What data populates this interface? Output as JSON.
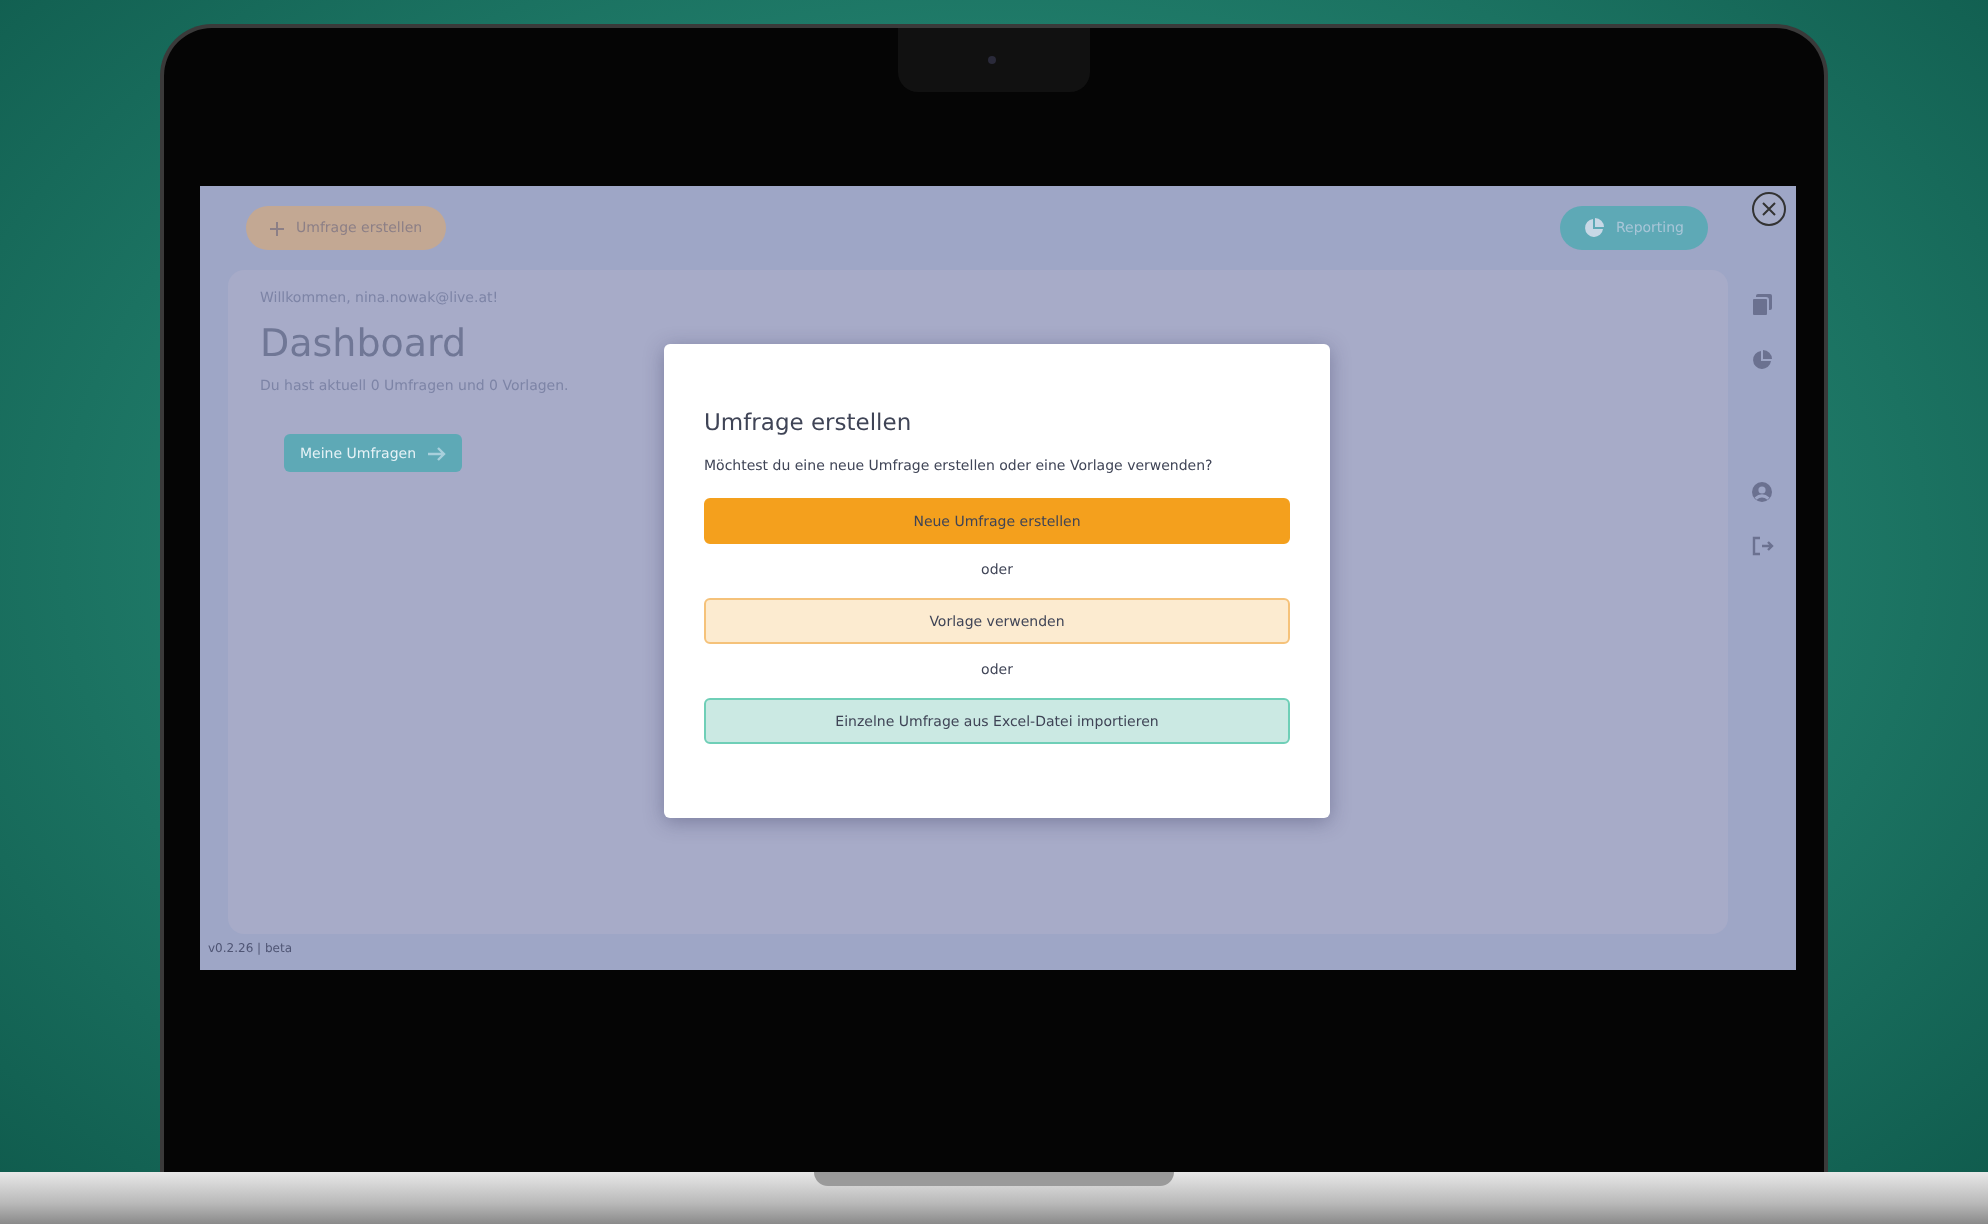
{
  "app": {
    "create_button": "Umfrage erstellen",
    "reporting_button": "Reporting",
    "welcome": "Willkommen, nina.nowak@live.at!",
    "title": "Dashboard",
    "summary": "Du hast aktuell 0 Umfragen und 0 Vorlagen.",
    "my_surveys_button": "Meine Umfragen",
    "version": "v0.2.26 | beta"
  },
  "modal": {
    "title": "Umfrage erstellen",
    "question": "Möchtest du eine neue Umfrage erstellen oder eine Vorlage verwenden?",
    "options": [
      {
        "kind": "primary",
        "label": "Neue Umfrage erstellen"
      },
      {
        "kind": "separator",
        "label": "oder"
      },
      {
        "kind": "secondary",
        "label": "Vorlage verwenden"
      },
      {
        "kind": "separator",
        "label": "oder"
      },
      {
        "kind": "import",
        "label": "Einzelne Umfrage aus Excel-Datei importieren"
      }
    ]
  }
}
